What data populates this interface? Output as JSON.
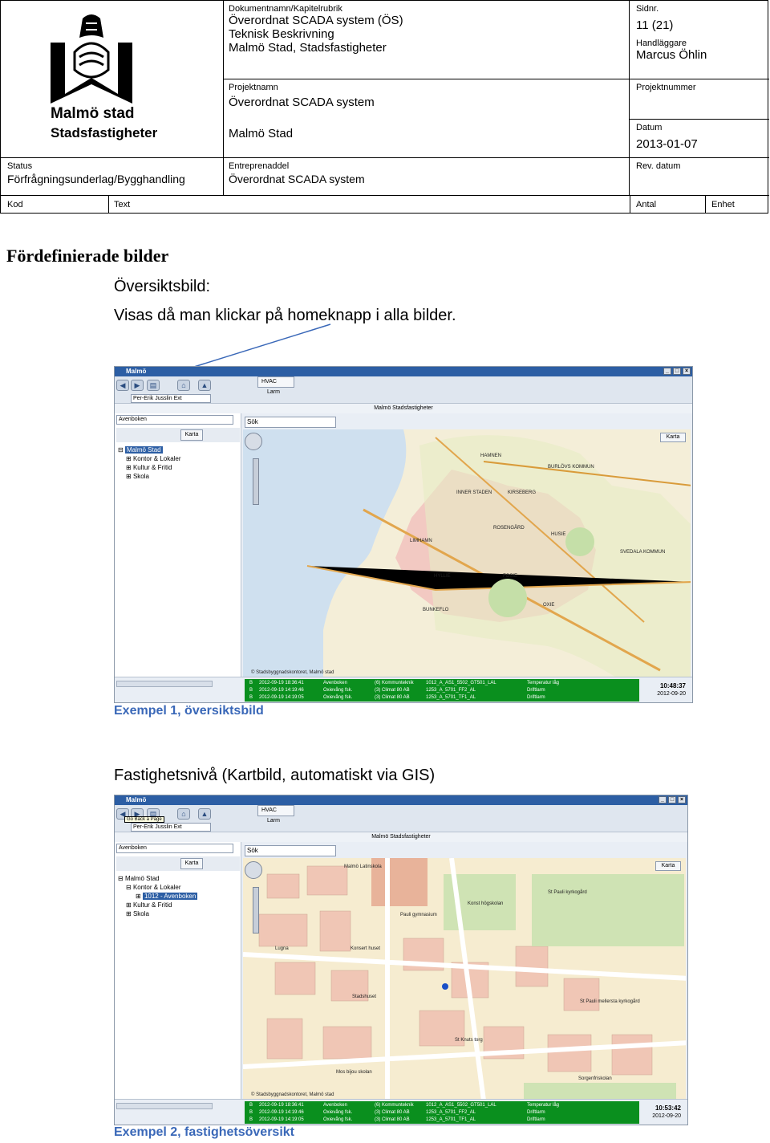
{
  "header": {
    "logo": {
      "line1": "Malmö stad",
      "line2": "Stadsfastigheter"
    },
    "doc_label": "Dokumentnamn/Kapitelrubrik",
    "doc_lines": [
      "Överordnat SCADA system (ÖS)",
      "Teknisk Beskrivning",
      "Malmö Stad, Stadsfastigheter"
    ],
    "sidnr_label": "Sidnr.",
    "sidnr": "11 (21)",
    "handlaggare_label": "Handläggare",
    "handlaggare": "Marcus Öhlin",
    "projektnamn_label": "Projektnamn",
    "projektnamn": "Överordnat SCADA system",
    "projektnamn2": "Malmö Stad",
    "projektnummer_label": "Projektnummer",
    "datum_label": "Datum",
    "datum": "2013-01-07",
    "status_label": "Status",
    "status": "Förfrågningsunderlag/Bygghandling",
    "entreprenaddel_label": "Entreprenaddel",
    "entreprenaddel": "Överordnat SCADA system",
    "rev_label": "Rev. datum",
    "cols": {
      "kod": "Kod",
      "text": "Text",
      "antal": "Antal",
      "enhet": "Enhet"
    }
  },
  "body": {
    "heading": "Fördefinierade bilder",
    "oversikt": "Översiktsbild:",
    "visas": "Visas då man klickar på homeknapp i alla bilder.",
    "caption1": "Exempel 1, översiktsbild",
    "fastighet": "Fastighetsnivå (Kartbild, automatiskt via GIS)",
    "caption2": "Exempel 2, fastighetsöversikt"
  },
  "screen1": {
    "title": "Malmö",
    "user": "Per-Erik Jusslin Ext",
    "tab": "HVAC",
    "larm": "Larm",
    "system": "Malmö Stadsfastigheter",
    "combo": "Avenboken",
    "karta": "Karta",
    "search": "Sök",
    "tree": [
      "Malmö Stad",
      "Kontor & Lokaler",
      "Kultur & Fritid",
      "Skola"
    ],
    "map_labels": [
      "HAMNEN",
      "BURLÖVS KOMMUN",
      "KIRSEBERG",
      "INNER STADEN",
      "ROSENGÅRD",
      "HUSIE",
      "LIMHAMN",
      "HYLLIE",
      "FOSIE",
      "SVEDALA KOMMUN",
      "OXIE",
      "BUNKEFLO",
      "© Stadsbyggnadskontoret, Malmö stad"
    ],
    "alarms": [
      {
        "s": "B",
        "time": "2012-09-19 18:36:41",
        "obj": "Avenboken",
        "sys": "(6) Kommunteknik",
        "tag": "1012_A_AS1_5502_GT501_LAL",
        "desc": "Temperatur låg"
      },
      {
        "s": "B",
        "time": "2012-09-19 14:19:46",
        "obj": "Oxievång fsk.",
        "sys": "(3) Climat 80 AB",
        "tag": "1253_A_5701_FF2_AL",
        "desc": "Driftlarm"
      },
      {
        "s": "B",
        "time": "2012-09-19 14:19:05",
        "obj": "Oxievång fsk.",
        "sys": "(3) Climat 80 AB",
        "tag": "1253_A_5701_TF1_AL",
        "desc": "Driftlarm"
      }
    ],
    "clock_time": "10:48:37",
    "clock_date": "2012-09-20"
  },
  "screen2": {
    "title": "Malmö",
    "user": "Per-Erik Jusslin Ext",
    "tooltip": "Go Back a Page",
    "tab": "HVAC",
    "larm": "Larm",
    "system": "Malmö Stadsfastigheter",
    "combo": "Avenboken",
    "karta": "Karta",
    "search": "Sök",
    "tree": [
      "Malmö Stad",
      "Kontor & Lokaler",
      "1012 - Avenboken",
      "Kultur & Fritid",
      "Skola"
    ],
    "map_labels": [
      "Malmö Latinskola",
      "St Pauli kyrkogård",
      "Konst högskolan",
      "Pauli gymnasium",
      "Konsert huset",
      "Stadshuset",
      "Mos bijou skolan",
      "St Pauli mellersta kyrkogård",
      "St Knuts torg",
      "Sorgenfriskolan",
      "Lugna",
      "© Stadsbyggnadskontoret, Malmö stad"
    ],
    "alarms": [
      {
        "s": "B",
        "time": "2012-09-19 18:36:41",
        "obj": "Avenboken",
        "sys": "(6) Kommunteknik",
        "tag": "1012_A_AS1_5502_GT501_LAL",
        "desc": "Temperatur låg"
      },
      {
        "s": "B",
        "time": "2012-09-19 14:19:46",
        "obj": "Oxievång fsk.",
        "sys": "(3) Climat 80 AB",
        "tag": "1253_A_5701_FF2_AL",
        "desc": "Driftlarm"
      },
      {
        "s": "B",
        "time": "2012-09-19 14:19:05",
        "obj": "Oxievång fsk.",
        "sys": "(3) Climat 80 AB",
        "tag": "1253_A_5701_TF1_AL",
        "desc": "Driftlarm"
      }
    ],
    "clock_time": "10:53:42",
    "clock_date": "2012-09-20"
  }
}
